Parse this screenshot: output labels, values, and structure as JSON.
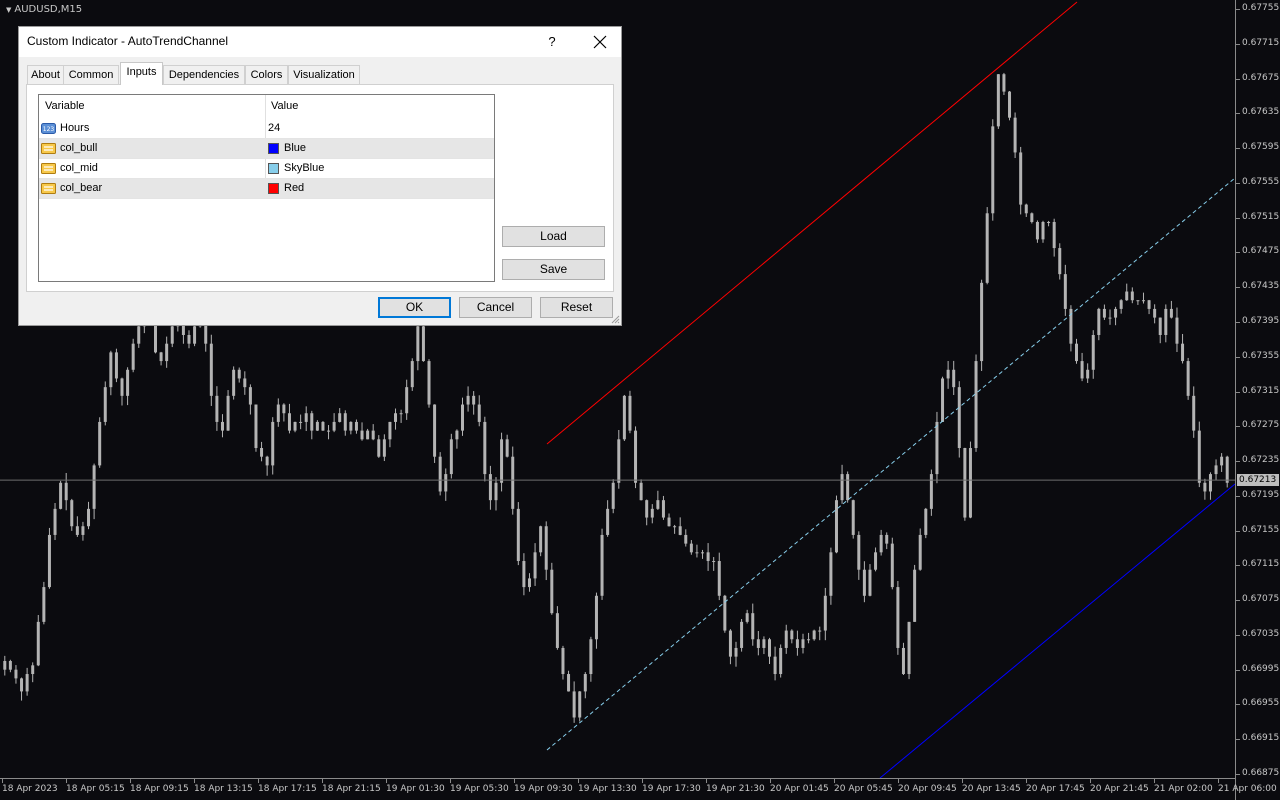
{
  "chart": {
    "symbol": "AUDUSD,M15",
    "current_price": "0.67213",
    "price_labels": [
      "0.67755",
      "0.67715",
      "0.67675",
      "0.67635",
      "0.67595",
      "0.67555",
      "0.67515",
      "0.67475",
      "0.67435",
      "0.67395",
      "0.67355",
      "0.67315",
      "0.67275",
      "0.67235",
      "0.67195",
      "0.67155",
      "0.67115",
      "0.67075",
      "0.67035",
      "0.66995",
      "0.66955",
      "0.66915",
      "0.66875"
    ],
    "time_labels": [
      "18 Apr 2023",
      "18 Apr 05:15",
      "18 Apr 09:15",
      "18 Apr 13:15",
      "18 Apr 17:15",
      "18 Apr 21:15",
      "19 Apr 01:30",
      "19 Apr 05:30",
      "19 Apr 09:30",
      "19 Apr 13:30",
      "19 Apr 17:30",
      "19 Apr 21:30",
      "20 Apr 01:45",
      "20 Apr 05:45",
      "20 Apr 09:45",
      "20 Apr 13:45",
      "20 Apr 17:45",
      "20 Apr 21:45",
      "21 Apr 02:00",
      "21 Apr 06:00"
    ],
    "colors": {
      "background": "#0b0b0f",
      "candles": "#b4b4b4",
      "upper_line": "#ff0000",
      "mid_line": "#87ceeb",
      "lower_line": "#0000ff"
    },
    "close_series": [
      0.67005,
      0.66995,
      0.66985,
      0.6697,
      0.6699,
      0.67,
      0.6705,
      0.6709,
      0.6715,
      0.6718,
      0.6721,
      0.6719,
      0.6716,
      0.6715,
      0.6716,
      0.6718,
      0.6723,
      0.6728,
      0.6732,
      0.6736,
      0.6733,
      0.6731,
      0.6734,
      0.6737,
      0.6739,
      0.6741,
      0.674,
      0.6736,
      0.6735,
      0.6737,
      0.6739,
      0.674,
      0.6738,
      0.6737,
      0.6739,
      0.674,
      0.6737,
      0.6731,
      0.6728,
      0.6727,
      0.6731,
      0.6734,
      0.6733,
      0.6732,
      0.673,
      0.6725,
      0.6724,
      0.6723,
      0.6728,
      0.673,
      0.6729,
      0.6727,
      0.6728,
      0.6728,
      0.6729,
      0.6727,
      0.6728,
      0.6727,
      0.6727,
      0.6728,
      0.6729,
      0.6727,
      0.6728,
      0.6727,
      0.6726,
      0.6727,
      0.6726,
      0.6724,
      0.6726,
      0.6728,
      0.6729,
      0.6729,
      0.6732,
      0.6735,
      0.6739,
      0.6735,
      0.673,
      0.6724,
      0.672,
      0.6722,
      0.6726,
      0.6727,
      0.673,
      0.6731,
      0.673,
      0.6728,
      0.6722,
      0.6719,
      0.6721,
      0.6726,
      0.6724,
      0.6718,
      0.6712,
      0.6709,
      0.671,
      0.6713,
      0.6716,
      0.6711,
      0.6706,
      0.6702,
      0.6699,
      0.6697,
      0.6694,
      0.6697,
      0.6699,
      0.6703,
      0.6708,
      0.6715,
      0.6718,
      0.6721,
      0.6726,
      0.6731,
      0.6727,
      0.6721,
      0.6719,
      0.6717,
      0.6718,
      0.6719,
      0.6717,
      0.6716,
      0.6716,
      0.6715,
      0.6714,
      0.6713,
      0.6713,
      0.6713,
      0.6712,
      0.6712,
      0.6708,
      0.6704,
      0.6701,
      0.6702,
      0.6705,
      0.6706,
      0.6703,
      0.6702,
      0.6703,
      0.6701,
      0.6699,
      0.6702,
      0.6704,
      0.6703,
      0.6702,
      0.6703,
      0.6703,
      0.6704,
      0.6704,
      0.6708,
      0.6713,
      0.6719,
      0.6722,
      0.6719,
      0.6715,
      0.6711,
      0.6708,
      0.6711,
      0.6713,
      0.6715,
      0.6714,
      0.6709,
      0.6702,
      0.6699,
      0.6705,
      0.6711,
      0.6715,
      0.6718,
      0.6722,
      0.6728,
      0.6733,
      0.6734,
      0.6732,
      0.6725,
      0.6717,
      0.6725,
      0.6735,
      0.6744,
      0.6752,
      0.6762,
      0.6768,
      0.6766,
      0.6763,
      0.6759,
      0.6753,
      0.6752,
      0.6751,
      0.6749,
      0.6751,
      0.6751,
      0.6748,
      0.6745,
      0.6741,
      0.6737,
      0.6735,
      0.6733,
      0.6734,
      0.6738,
      0.6741,
      0.674,
      0.674,
      0.6741,
      0.6742,
      0.6743,
      0.6742,
      0.6742,
      0.6742,
      0.6741,
      0.674,
      0.6738,
      0.6741,
      0.674,
      0.6737,
      0.6735,
      0.6731,
      0.6727,
      0.6721,
      0.672,
      0.6722,
      0.6723,
      0.6724,
      0.6721
    ]
  },
  "dialog": {
    "title": "Custom Indicator - AutoTrendChannel",
    "help_label": "?",
    "tabs": [
      "About",
      "Common",
      "Inputs",
      "Dependencies",
      "Colors",
      "Visualization"
    ],
    "active_tab": "Inputs",
    "grid": {
      "headers": {
        "variable": "Variable",
        "value": "Value"
      },
      "rows": [
        {
          "variable": "Hours",
          "value": "24",
          "icon": "number-icon"
        },
        {
          "variable": "col_bull",
          "value": "Blue",
          "swatch": "#0000ff",
          "icon": "color-icon"
        },
        {
          "variable": "col_mid",
          "value": "SkyBlue",
          "swatch": "#87ceeb",
          "icon": "color-icon"
        },
        {
          "variable": "col_bear",
          "value": "Red",
          "swatch": "#ff0000",
          "icon": "color-icon"
        }
      ]
    },
    "buttons": {
      "load": "Load",
      "save": "Save",
      "ok": "OK",
      "cancel": "Cancel",
      "reset": "Reset"
    }
  }
}
